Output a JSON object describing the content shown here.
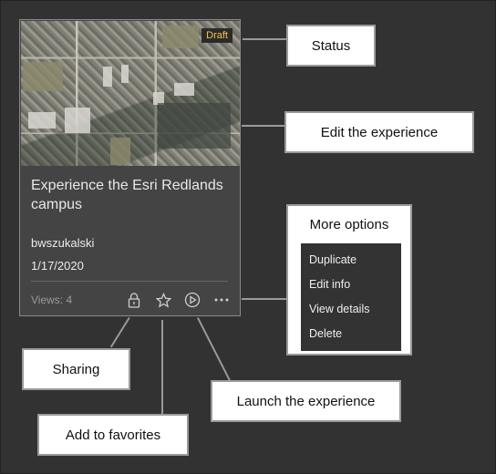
{
  "card": {
    "status_badge": "Draft",
    "title": "Experience the Esri Redlands campus",
    "owner": "bwszukalski",
    "date": "1/17/2020",
    "views": "Views: 4",
    "icons": [
      "lock-icon",
      "star-icon",
      "play-circle-icon",
      "more-options-icon"
    ]
  },
  "callouts": {
    "status": "Status",
    "edit": "Edit the experience",
    "sharing": "Sharing",
    "favorites": "Add to favorites",
    "launch": "Launch the experience"
  },
  "more_options": {
    "title": "More options",
    "items": [
      {
        "label": "Duplicate"
      },
      {
        "label": "Edit info"
      },
      {
        "label": "View details"
      },
      {
        "label": "Delete"
      }
    ]
  },
  "colors": {
    "background": "#323232",
    "card": "#444444",
    "badge_text": "#f2c44a",
    "menu": "#333333"
  }
}
